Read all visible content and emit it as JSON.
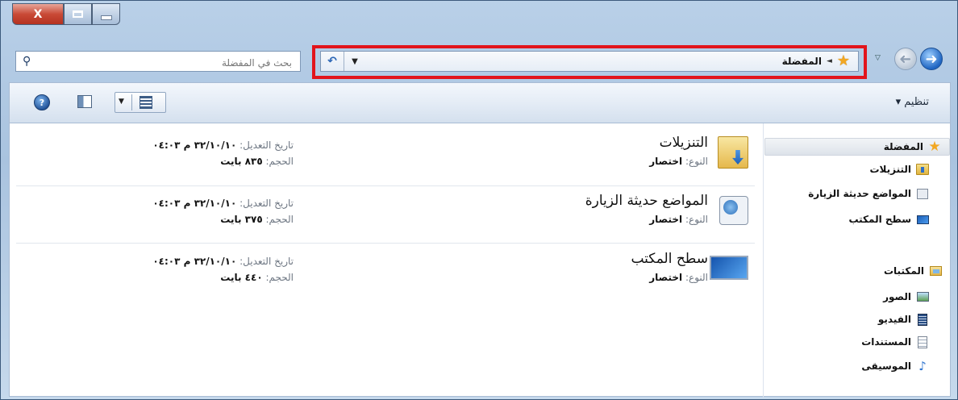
{
  "window": {
    "close_glyph": "X",
    "address": {
      "crumb": "المفضلة",
      "icon": "star-icon",
      "refresh_icon": "refresh-icon"
    },
    "search": {
      "placeholder": "بحث في المفضلة"
    }
  },
  "toolbar": {
    "organize_label": "تنظيم ▾"
  },
  "navpane": {
    "favorites": {
      "label": "المفضلة",
      "items": [
        {
          "label": "التنزيلات",
          "icon": "downloads-folder-icon"
        },
        {
          "label": "المواضع حديثة الزيارة",
          "icon": "recent-places-icon"
        },
        {
          "label": "سطح المكتب",
          "icon": "desktop-icon"
        }
      ]
    },
    "libraries": {
      "label": "المكتبات",
      "items": [
        {
          "label": "الصور",
          "icon": "pictures-icon"
        },
        {
          "label": "الفيديو",
          "icon": "videos-icon"
        },
        {
          "label": "المستندات",
          "icon": "documents-icon"
        },
        {
          "label": "الموسيقى",
          "icon": "music-icon"
        }
      ]
    }
  },
  "files": [
    {
      "name": "التنزيلات",
      "type_label": "النوع:",
      "type_value": "اختصار",
      "date_label": "تاريخ التعديل:",
      "date_value": "٣٢/١٠/١٠ م ٠٤:٠٣",
      "size_label": "الحجم:",
      "size_value": "٨٣٥ بايت",
      "icon": "downloads-folder-icon"
    },
    {
      "name": "المواضع حديثة الزيارة",
      "type_label": "النوع:",
      "type_value": "اختصار",
      "date_label": "تاريخ التعديل:",
      "date_value": "٣٢/١٠/١٠ م ٠٤:٠٣",
      "size_label": "الحجم:",
      "size_value": "٣٧٥ بايت",
      "icon": "recent-places-icon"
    },
    {
      "name": "سطح المكتب",
      "type_label": "النوع:",
      "type_value": "اختصار",
      "date_label": "تاريخ التعديل:",
      "date_value": "٣٢/١٠/١٠ م ٠٤:٠٣",
      "size_label": "الحجم:",
      "size_value": "٤٤٠ بايت",
      "icon": "desktop-icon"
    }
  ],
  "colors": {
    "highlight": "#e2141b",
    "accent": "#1f65c2"
  }
}
